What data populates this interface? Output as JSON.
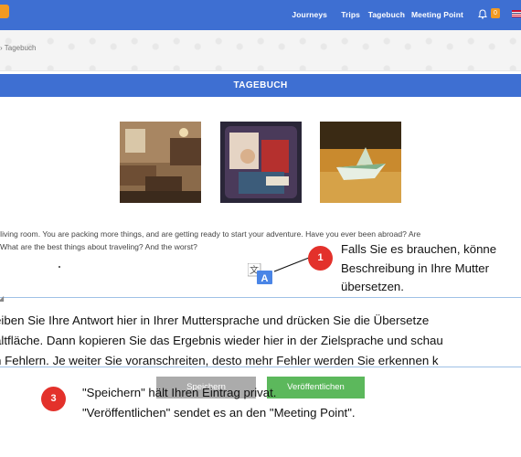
{
  "nav": {
    "items": [
      "Journeys",
      "Trips",
      "Tagebuch",
      "Meeting Point"
    ],
    "badge_count": "0"
  },
  "breadcrumb": "› Tagebuch",
  "title": "TAGEBUCH",
  "photos": [
    "living-room-photo",
    "suitcase-photo",
    "paper-boat-map-photo"
  ],
  "description": {
    "line1": "e living room. You are packing more things, and are getting ready to start your adventure. Have you ever been abroad? Are",
    "line2": "What are the best things about traveling? And the worst?"
  },
  "callout1": {
    "number": "1",
    "line1": "Falls Sie es brauchen, könne",
    "line2": "Beschreibung in Ihre Mutter",
    "line3": "übersetzen."
  },
  "answer": {
    "line1": "eiben Sie Ihre Antwort hier in Ihrer Muttersprache und drücken Sie die Übersetze",
    "line2": "altfläche. Dann kopieren Sie das Ergebnis wieder hier in der Zielsprache und schau",
    "line3": "n Fehlern. Je weiter Sie voranschreiten, desto mehr Fehler werden Sie erkennen k"
  },
  "buttons": {
    "save": "Speichern",
    "publish": "Veröffentlichen"
  },
  "callout3": {
    "number": "3",
    "line1": "\"Speichern\" hält Ihren Eintrag privat.",
    "line2": "\"Veröffentlichen\" sendet es an den \"Meeting Point\"."
  },
  "colors": {
    "primary": "#3e6fd2",
    "accent": "#f29a22",
    "callout": "#e3312b",
    "publish": "#5cb85c",
    "save": "#ababab"
  }
}
